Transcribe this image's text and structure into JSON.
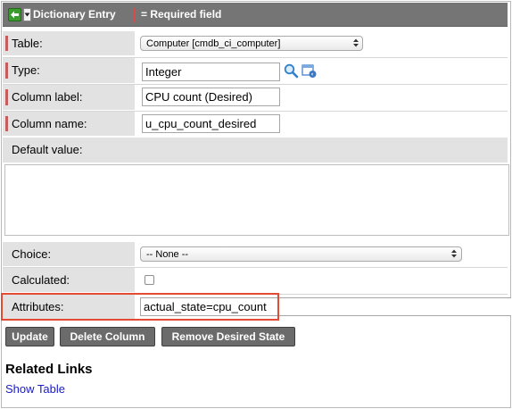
{
  "header": {
    "title": "Dictionary Entry",
    "required_legend": "= Required field"
  },
  "form": {
    "table": {
      "label": "Table:",
      "value": "Computer [cmdb_ci_computer]"
    },
    "type": {
      "label": "Type:",
      "value": "Integer"
    },
    "column_label": {
      "label": "Column label:",
      "value": "CPU count (Desired)"
    },
    "column_name": {
      "label": "Column name:",
      "value": "u_cpu_count_desired"
    },
    "default_value": {
      "label": "Default value:",
      "value": ""
    },
    "choice": {
      "label": "Choice:",
      "value": "-- None --"
    },
    "calculated": {
      "label": "Calculated:",
      "checked": false
    },
    "attributes": {
      "label": "Attributes:",
      "value": "actual_state=cpu_count"
    }
  },
  "buttons": {
    "update": "Update",
    "delete_column": "Delete Column",
    "remove_desired_state": "Remove Desired State"
  },
  "related": {
    "title": "Related Links",
    "show_table": "Show Table"
  },
  "colors": {
    "header_bg": "#757575",
    "label_bg": "#e2e2e2",
    "required_marker": "#c75c5c",
    "highlight": "#e24c32",
    "link": "#1a1acc"
  }
}
